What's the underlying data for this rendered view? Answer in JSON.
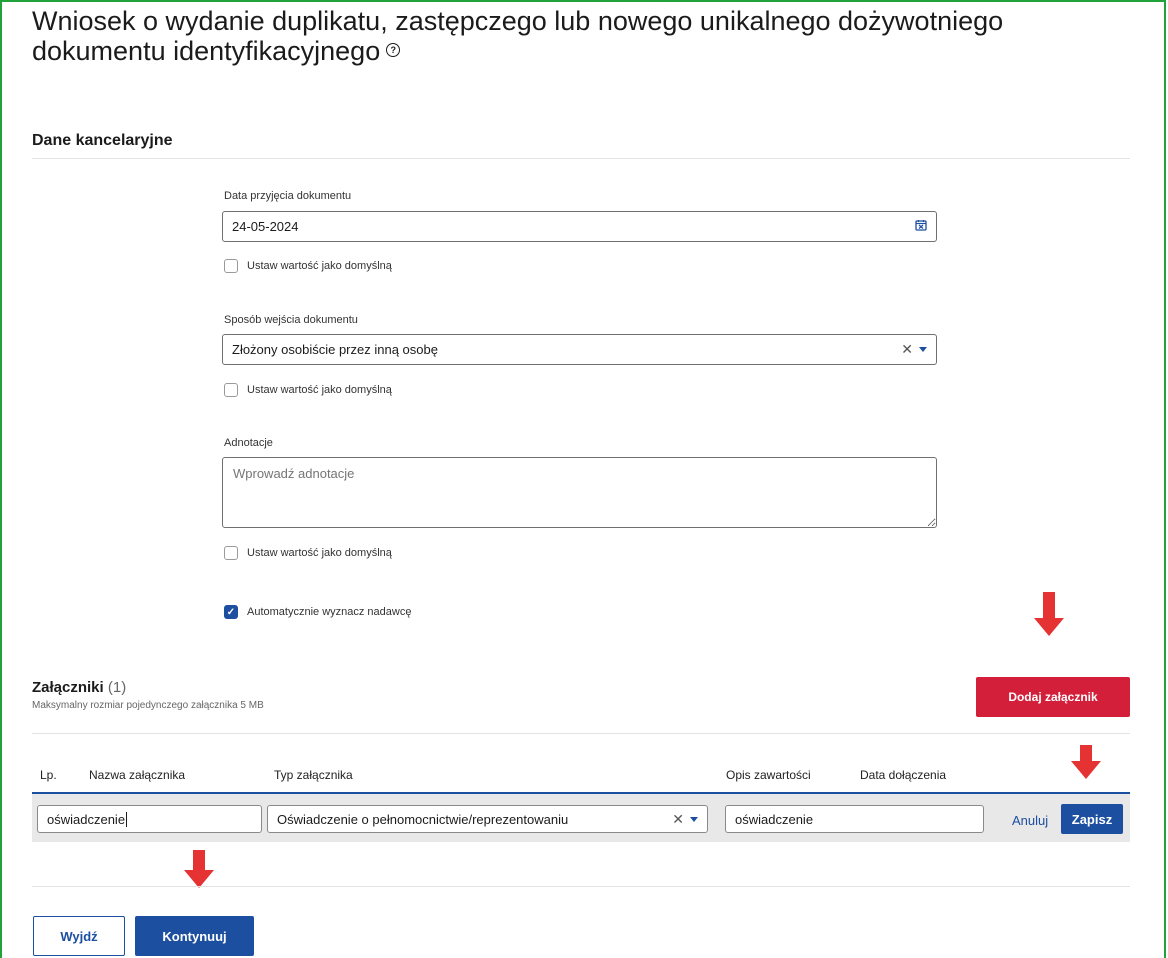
{
  "page": {
    "title_line1": "Wniosek o wydanie duplikatu, zastępczego lub nowego unikalnego dożywotniego",
    "title_line2": "dokumentu identyfikacyjnego",
    "help_glyph": "?"
  },
  "office": {
    "section_title": "Dane kancelaryjne",
    "date": {
      "label": "Data przyjęcia dokumentu",
      "value": "24-05-2024"
    },
    "entry_method": {
      "label": "Sposób wejścia dokumentu",
      "value": "Złożony osobiście przez inną osobę"
    },
    "annotations": {
      "label": "Adnotacje",
      "placeholder": "Wprowadź adnotacje"
    },
    "default_checkbox_label": "Ustaw wartość jako domyślną",
    "auto_sender_label": "Automatycznie wyznacz nadawcę"
  },
  "attachments": {
    "title": "Załączniki",
    "count": "(1)",
    "max_size_note": "Maksymalny rozmiar pojedynczego załącznika 5 MB",
    "add_button": "Dodaj załącznik",
    "columns": [
      "Lp.",
      "Nazwa załącznika",
      "Typ załącznika",
      "Opis zawartości",
      "Data dołączenia"
    ],
    "row": {
      "name_value": "oświadczenie",
      "type_value": "Oświadczenie o pełnomocnictwie/reprezentowaniu",
      "description_value": "oświadczenie",
      "cancel_label": "Anuluj",
      "save_label": "Zapisz"
    }
  },
  "footer": {
    "exit_button": "Wyjdź",
    "continue_button": "Kontynuuj"
  },
  "colors": {
    "primary": "#1c4fa0",
    "danger": "#d31f3a",
    "annotation_arrow": "#e53333",
    "frame": "#1fa33a"
  },
  "icons": {
    "calendar": "calendar-icon",
    "clear": "clear-icon",
    "dropdown": "chevron-down-icon",
    "check": "checkmark-icon",
    "help": "help-icon"
  }
}
